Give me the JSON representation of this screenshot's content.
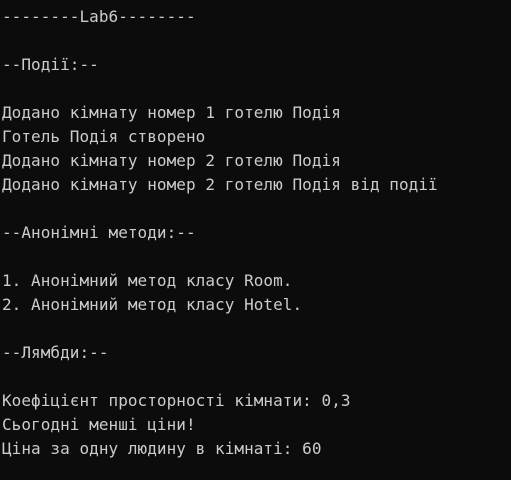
{
  "console": {
    "lines": [
      "--------Lab6--------",
      "",
      "--Події:--",
      "",
      "Додано кімнату номер 1 готелю Подія",
      "Готель Подія створено",
      "Додано кімнату номер 2 готелю Подія",
      "Додано кімнату номер 2 готелю Подія від події",
      "",
      "--Анонімні методи:--",
      "",
      "1. Анонімний метод класу Room.",
      "2. Анонімний метод класу Hotel.",
      "",
      "--Лямбди:--",
      "",
      "Коефіцієнт просторності кімнати: 0,3",
      "Сьогодні менші ціни!",
      "Ціна за одну людину в кімнаті: 60"
    ],
    "colors": {
      "background": "#0c0c0c",
      "text": "#cccccc"
    }
  }
}
